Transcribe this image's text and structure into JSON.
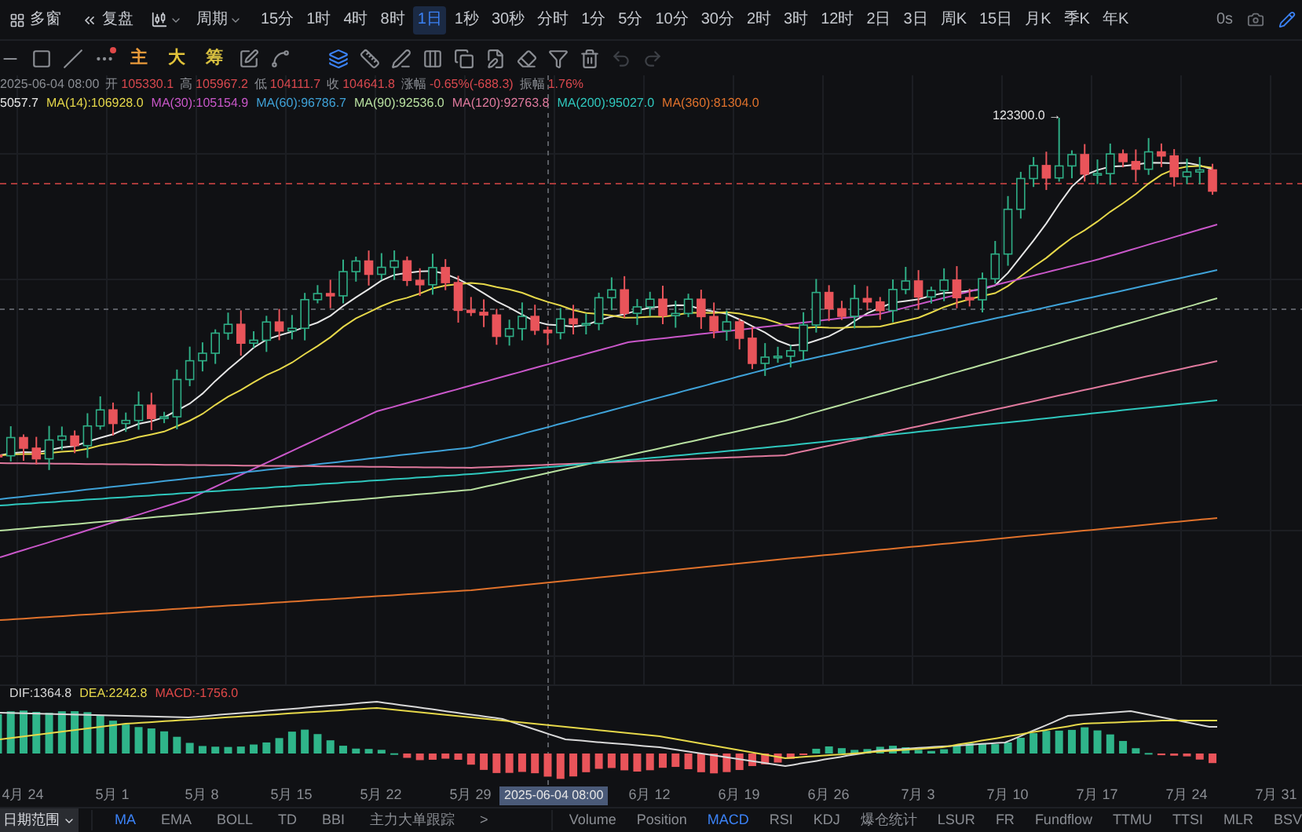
{
  "top_bar": {
    "window_button": "多窗",
    "replay_button": "复盘",
    "period_menu": "周期",
    "intervals": [
      {
        "label": "15分",
        "selected": false
      },
      {
        "label": "1时",
        "selected": false
      },
      {
        "label": "4时",
        "selected": false
      },
      {
        "label": "8时",
        "selected": false
      },
      {
        "label": "1日",
        "selected": true
      },
      {
        "label": "1秒",
        "selected": false
      },
      {
        "label": "30秒",
        "selected": false
      },
      {
        "label": "分时",
        "selected": false
      },
      {
        "label": "1分",
        "selected": false
      },
      {
        "label": "5分",
        "selected": false
      },
      {
        "label": "10分",
        "selected": false
      },
      {
        "label": "30分",
        "selected": false
      },
      {
        "label": "2时",
        "selected": false
      },
      {
        "label": "3时",
        "selected": false
      },
      {
        "label": "12时",
        "selected": false
      },
      {
        "label": "2日",
        "selected": false
      },
      {
        "label": "3日",
        "selected": false
      },
      {
        "label": "周K",
        "selected": false
      },
      {
        "label": "15日",
        "selected": false
      },
      {
        "label": "月K",
        "selected": false
      },
      {
        "label": "季K",
        "selected": false
      },
      {
        "label": "年K",
        "selected": false
      }
    ],
    "countdown": "0s"
  },
  "drawing_toolbar": {
    "text_tools": [
      {
        "label": "主",
        "color": "#e89a3a"
      },
      {
        "label": "大",
        "color": "#e0c23a"
      },
      {
        "label": "筹",
        "color": "#d8c040"
      }
    ]
  },
  "ohlc": {
    "date": "2025-06-04 08:00",
    "fields": [
      {
        "label": "开",
        "value": "105330.1"
      },
      {
        "label": "高",
        "value": "105967.2"
      },
      {
        "label": "低",
        "value": "104111.7"
      },
      {
        "label": "收",
        "value": "104641.8"
      },
      {
        "label": "涨幅",
        "value": "-0.65%(-688.3)"
      },
      {
        "label": "振幅",
        "value": "1.76%"
      }
    ]
  },
  "moving_averages": [
    {
      "label": "5057.7",
      "color": "#e6e6e6"
    },
    {
      "label": "MA(14):106928.0",
      "color": "#e6d84a"
    },
    {
      "label": "MA(30):105154.9",
      "color": "#c957c9"
    },
    {
      "label": "MA(60):96786.7",
      "color": "#3fa2d8"
    },
    {
      "label": "MA(90):92536.0",
      "color": "#b8e0a0"
    },
    {
      "label": "MA(120):92763.8",
      "color": "#e07a9e"
    },
    {
      "label": "MA(200):95027.0",
      "color": "#2fc8be"
    },
    {
      "label": "MA(360):81304.0",
      "color": "#e0722c"
    }
  ],
  "price_marker": "123300.0 →",
  "macd": [
    {
      "label": "DIF:1364.8",
      "color": "#d8d8d8"
    },
    {
      "label": "DEA:2242.8",
      "color": "#e6d84a"
    },
    {
      "label": "MACD:-1756.0",
      "color": "#e04848"
    }
  ],
  "x_axis": {
    "ticks": [
      "4月 24",
      "5月 1",
      "5月 8",
      "5月 15",
      "5月 22",
      "5月 29",
      "6月 12",
      "6月 19",
      "6月 26",
      "7月 3",
      "7月 10",
      "7月 17",
      "7月 24",
      "7月 31"
    ],
    "cursor_label": "2025-06-04 08:00"
  },
  "bottom_bar": {
    "range_button": "日期范围",
    "main_indicators": [
      {
        "label": "MA",
        "selected": true
      },
      {
        "label": "EMA",
        "selected": false
      },
      {
        "label": "BOLL",
        "selected": false
      },
      {
        "label": "TD",
        "selected": false
      },
      {
        "label": "BBI",
        "selected": false
      },
      {
        "label": "主力大单跟踪",
        "selected": false
      }
    ],
    "more": ">",
    "sub_indicators": [
      {
        "label": "Volume",
        "selected": false
      },
      {
        "label": "Position",
        "selected": false
      },
      {
        "label": "MACD",
        "selected": true
      },
      {
        "label": "RSI",
        "selected": false
      },
      {
        "label": "KDJ",
        "selected": false
      },
      {
        "label": "爆仓统计",
        "selected": false
      },
      {
        "label": "LSUR",
        "selected": false
      },
      {
        "label": "FR",
        "selected": false
      },
      {
        "label": "Fundflow",
        "selected": false
      },
      {
        "label": "TTMU",
        "selected": false
      },
      {
        "label": "TTSI",
        "selected": false
      },
      {
        "label": "MLR",
        "selected": false
      },
      {
        "label": "BSV",
        "selected": false
      }
    ]
  }
}
